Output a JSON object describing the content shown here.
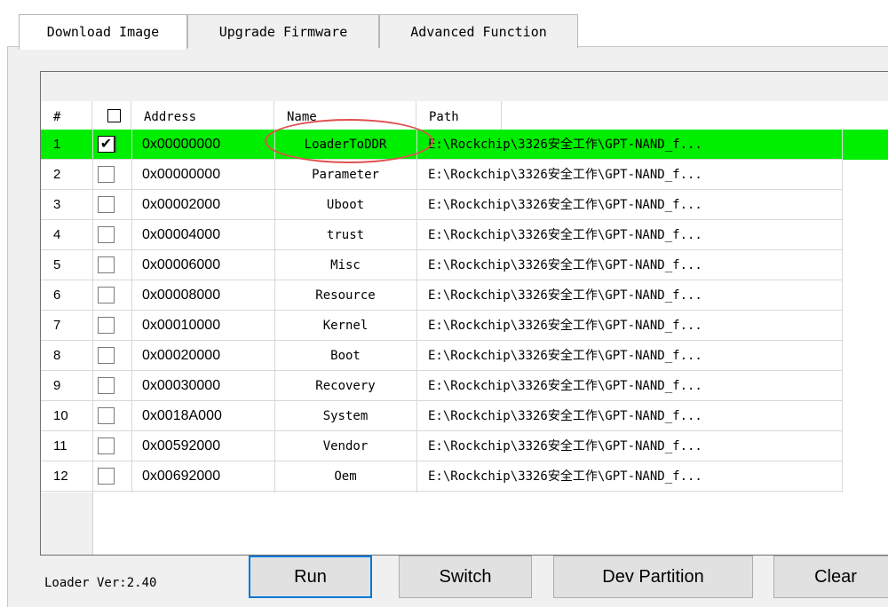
{
  "tabs": [
    {
      "label": "Download Image",
      "active": true
    },
    {
      "label": "Upgrade Firmware",
      "active": false
    },
    {
      "label": "Advanced Function",
      "active": false
    }
  ],
  "table": {
    "columns": [
      "#",
      "",
      "Address",
      "Name",
      "Path"
    ],
    "rows": [
      {
        "num": "1",
        "checked": true,
        "address": "0x00000000",
        "name": "LoaderToDDR",
        "path": "E:\\Rockchip\\3326安全工作\\GPT-NAND_f...",
        "selected": true
      },
      {
        "num": "2",
        "checked": false,
        "address": "0x00000000",
        "name": "Parameter",
        "path": "E:\\Rockchip\\3326安全工作\\GPT-NAND_f..."
      },
      {
        "num": "3",
        "checked": false,
        "address": "0x00002000",
        "name": "Uboot",
        "path": "E:\\Rockchip\\3326安全工作\\GPT-NAND_f..."
      },
      {
        "num": "4",
        "checked": false,
        "address": "0x00004000",
        "name": "trust",
        "path": "E:\\Rockchip\\3326安全工作\\GPT-NAND_f..."
      },
      {
        "num": "5",
        "checked": false,
        "address": "0x00006000",
        "name": "Misc",
        "path": "E:\\Rockchip\\3326安全工作\\GPT-NAND_f..."
      },
      {
        "num": "6",
        "checked": false,
        "address": "0x00008000",
        "name": "Resource",
        "path": "E:\\Rockchip\\3326安全工作\\GPT-NAND_f..."
      },
      {
        "num": "7",
        "checked": false,
        "address": "0x00010000",
        "name": "Kernel",
        "path": "E:\\Rockchip\\3326安全工作\\GPT-NAND_f..."
      },
      {
        "num": "8",
        "checked": false,
        "address": "0x00020000",
        "name": "Boot",
        "path": "E:\\Rockchip\\3326安全工作\\GPT-NAND_f..."
      },
      {
        "num": "9",
        "checked": false,
        "address": "0x00030000",
        "name": "Recovery",
        "path": "E:\\Rockchip\\3326安全工作\\GPT-NAND_f..."
      },
      {
        "num": "10",
        "checked": false,
        "address": "0x0018A000",
        "name": "System",
        "path": "E:\\Rockchip\\3326安全工作\\GPT-NAND_f..."
      },
      {
        "num": "11",
        "checked": false,
        "address": "0x00592000",
        "name": "Vendor",
        "path": "E:\\Rockchip\\3326安全工作\\GPT-NAND_f..."
      },
      {
        "num": "12",
        "checked": false,
        "address": "0x00692000",
        "name": "Oem",
        "path": "E:\\Rockchip\\3326安全工作\\GPT-NAND_f..."
      }
    ]
  },
  "footer": {
    "loader_version": "Loader Ver:2.40",
    "run_label": "Run",
    "switch_label": "Switch",
    "dev_partition_label": "Dev Partition",
    "clear_label": "Clear"
  },
  "colors": {
    "selected_row": "#00ee00",
    "annotation": "#e05050",
    "focus_border": "#0078d7"
  }
}
